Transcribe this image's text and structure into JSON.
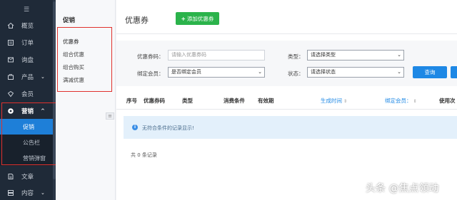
{
  "sidebar": {
    "menu_icon": "hamburger-icon",
    "items": [
      {
        "label": "概览",
        "icon": "home-icon"
      },
      {
        "label": "订单",
        "icon": "order-icon"
      },
      {
        "label": "询盘",
        "icon": "inquiry-icon"
      },
      {
        "label": "产品",
        "icon": "product-icon",
        "chevron": "⌄"
      },
      {
        "label": "会员",
        "icon": "member-icon"
      },
      {
        "label": "营销",
        "icon": "marketing-icon",
        "chevron": "^"
      },
      {
        "label": "文章",
        "icon": "article-icon"
      },
      {
        "label": "内容",
        "icon": "content-icon",
        "chevron": "⌄"
      }
    ],
    "sub_items": [
      "促销",
      "公告栏",
      "营销弹窗"
    ]
  },
  "subnav": {
    "title": "促销",
    "items": [
      "优惠券",
      "组合优惠",
      "组合购买",
      "满减优惠"
    ]
  },
  "main": {
    "title": "优惠券",
    "add_button": "添加优惠券",
    "filters": {
      "code_label": "优惠券码：",
      "code_placeholder": "请输入优惠券码",
      "type_label": "类型：",
      "type_value": "请选择类型",
      "member_label": "绑定会员：",
      "member_value": "是否绑定会员",
      "status_label": "状态：",
      "status_value": "请选择状态",
      "query_button": "查询"
    },
    "table": {
      "headers": [
        "序号",
        "优惠券码",
        "类型",
        "消费条件",
        "有效期",
        "生成时间",
        "绑定会员：",
        "使用次"
      ],
      "empty_text": "无符合条件的记录显示!",
      "total": "共 0 条记录"
    }
  },
  "watermark": "头条 @焦点领动",
  "colors": {
    "sidebar_bg": "#1f2a38",
    "active_blue": "#1e7fd8",
    "add_green": "#2bb34b",
    "highlight_red": "#e0312d"
  }
}
